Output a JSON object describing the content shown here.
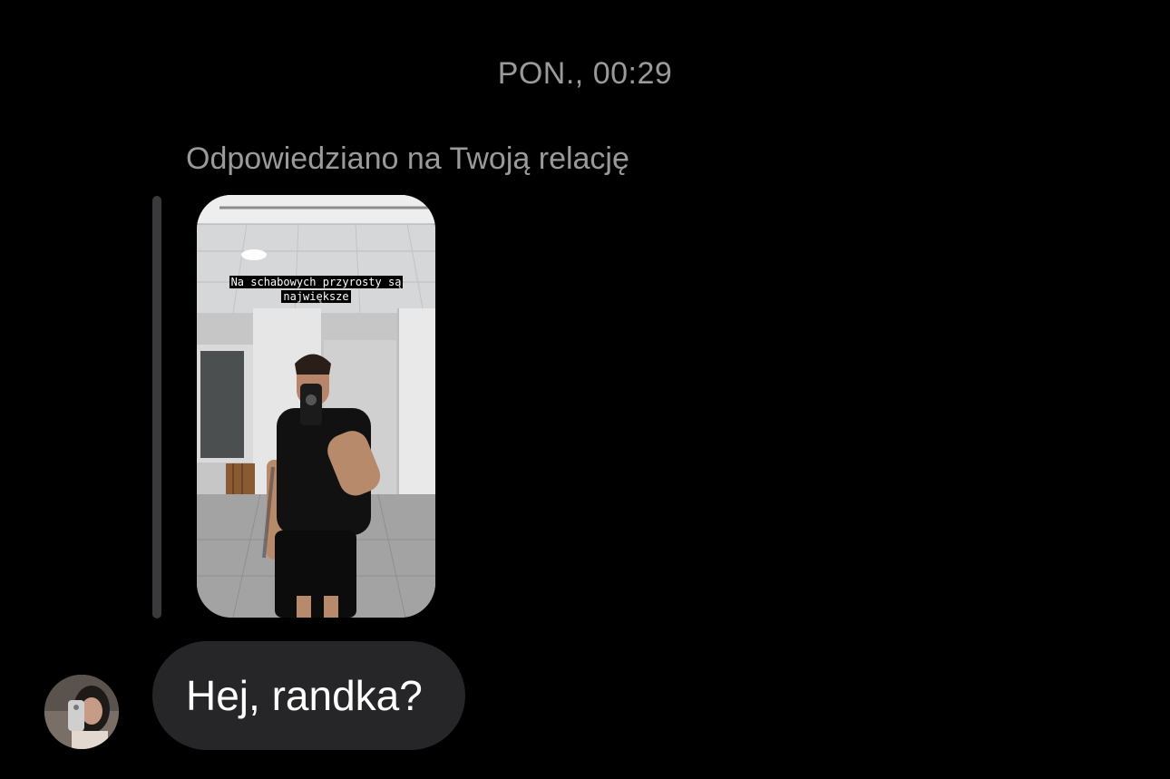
{
  "conversation": {
    "timestamp": "PON., 00:29",
    "reply_label": "Odpowiedziano na Twoją relację",
    "story": {
      "caption_line1": "Na schabowych przyrosty są",
      "caption_line2": "największe"
    },
    "message": {
      "text": "Hej, randka?"
    }
  },
  "colors": {
    "background": "#000000",
    "secondary_text": "#9a9a9a",
    "bubble": "#262628",
    "reply_bar": "#3a3a3c"
  }
}
